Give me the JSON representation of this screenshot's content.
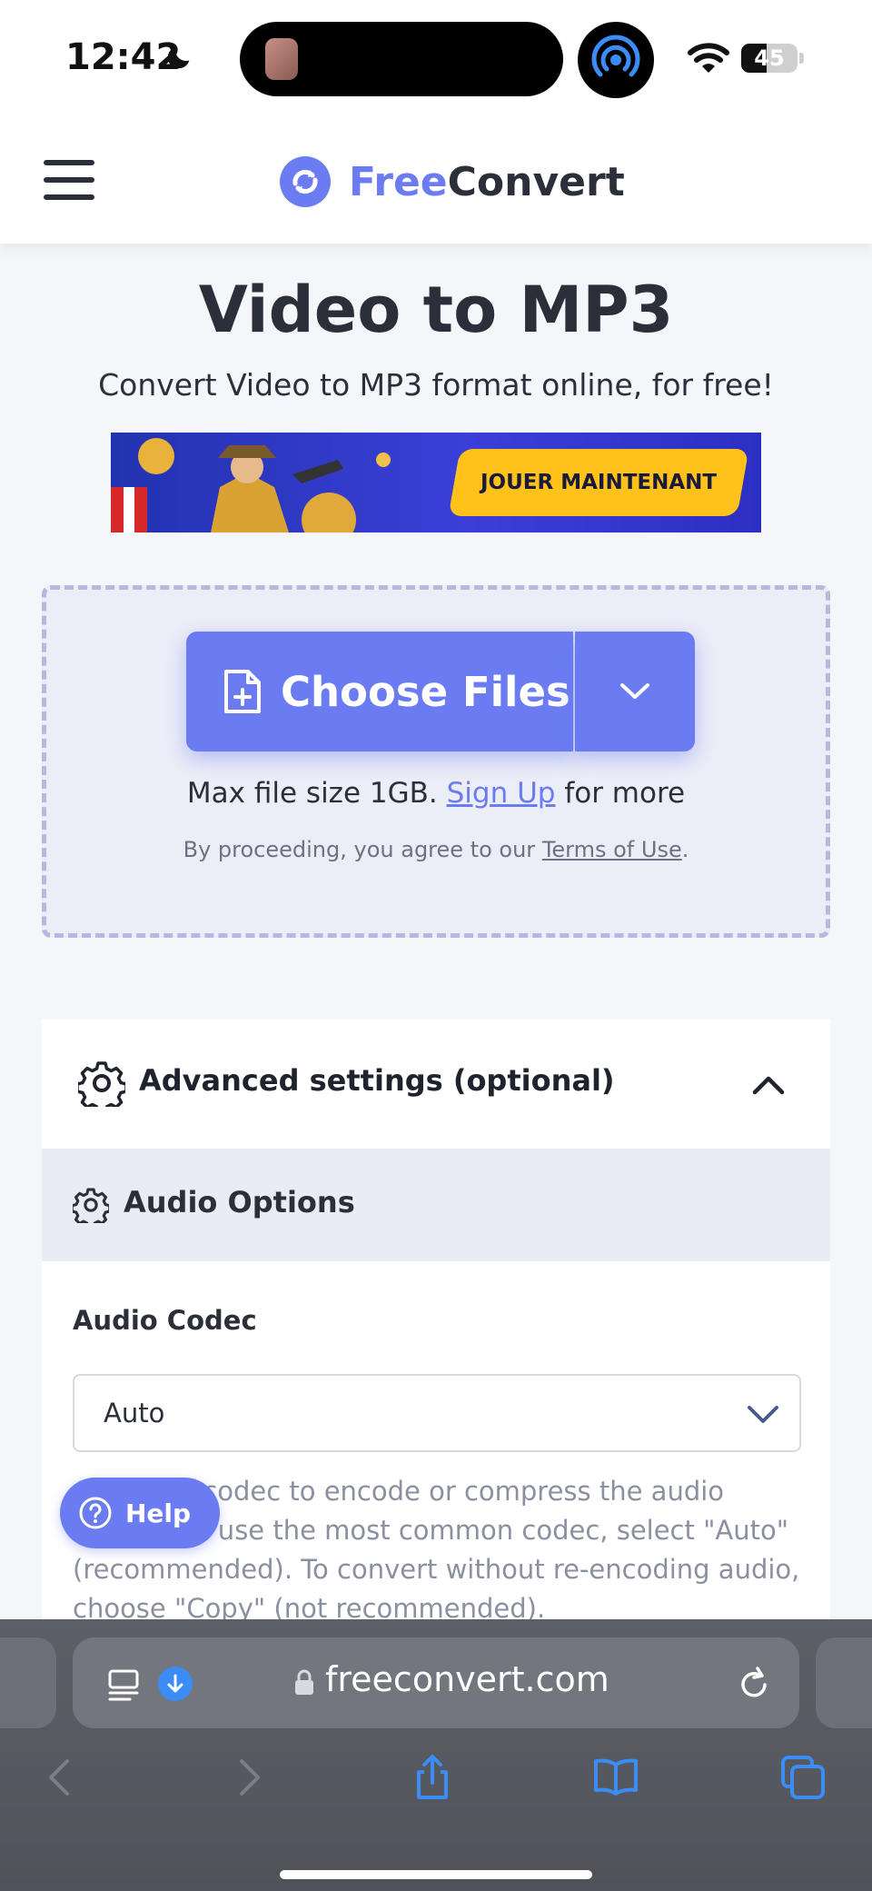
{
  "status_bar": {
    "time": "12:42",
    "battery": "45",
    "battery_level": 0.45
  },
  "header": {
    "logo_part1": "Free",
    "logo_part2": "Convert"
  },
  "hero": {
    "title": "Video to MP3",
    "subtitle": "Convert Video to MP3 format online, for free!"
  },
  "ad": {
    "cta": "JOUER MAINTENANT"
  },
  "upload": {
    "choose_files": "Choose Files",
    "max_size_prefix": "Max file size 1GB.",
    "sign_up": "Sign Up",
    "max_size_suffix": "for more",
    "terms_prefix": "By proceeding, you agree to our",
    "terms_link": "Terms of Use",
    "terms_suffix": "."
  },
  "advanced": {
    "title": "Advanced settings (optional)",
    "audio_options": "Audio Options",
    "codec_label": "Audio Codec",
    "codec_value": "Auto",
    "codec_help": "Choose a codec to encode or compress the audio stream. To use the most common codec, select \"Auto\" (recommended). To convert without re-encoding audio, choose \"Copy\" (not recommended)."
  },
  "help": {
    "label": "Help"
  },
  "browser": {
    "url": "freeconvert.com"
  },
  "colors": {
    "brand": "#6b7cf2",
    "text": "#2b2f3a",
    "muted": "#8b90a0",
    "ad_button": "#ffc21a"
  }
}
